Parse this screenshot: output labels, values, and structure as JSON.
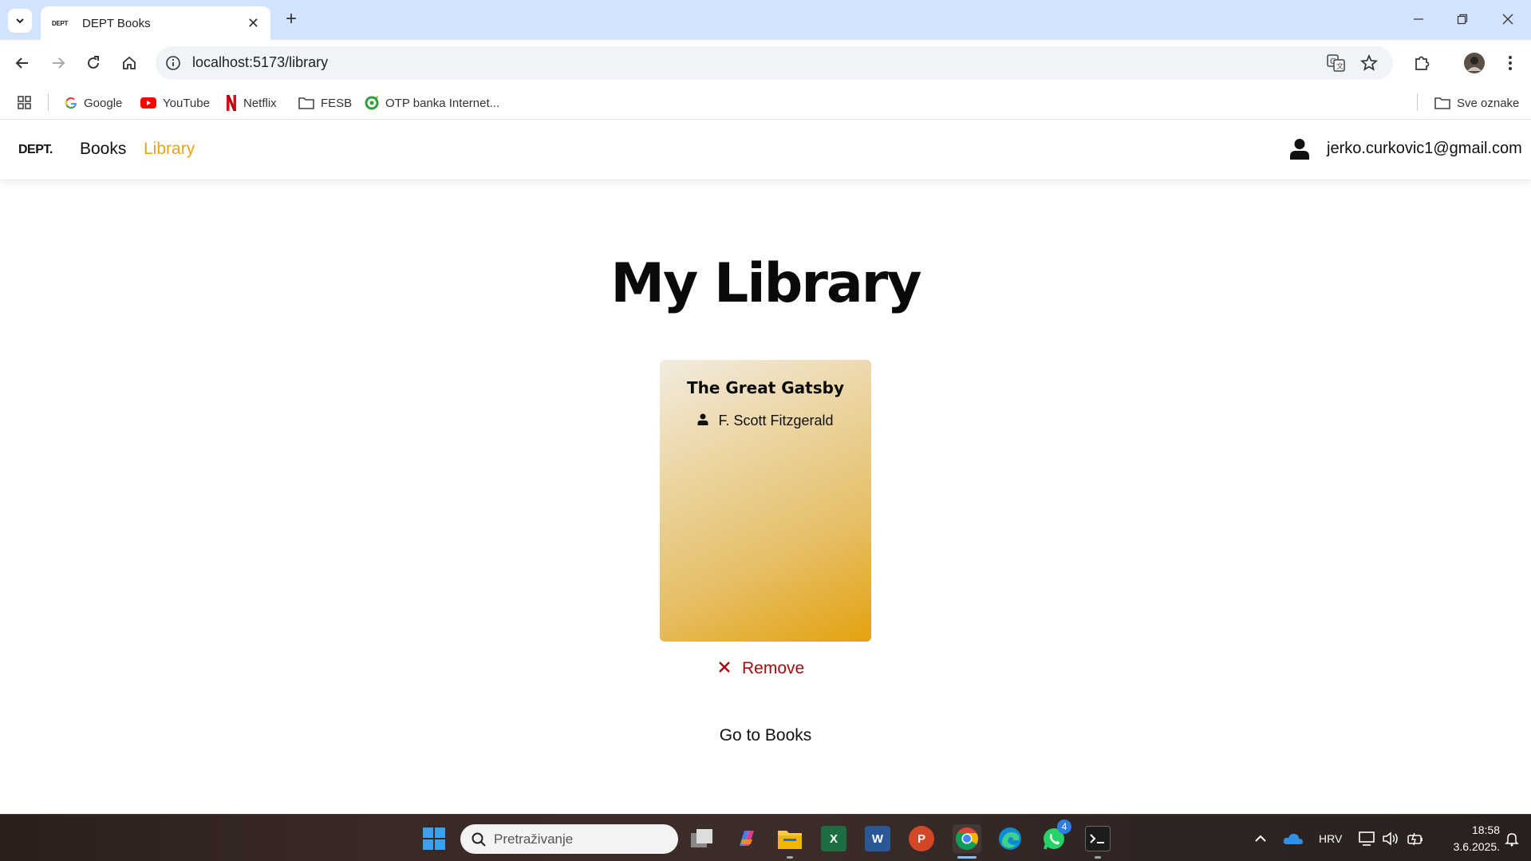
{
  "browser": {
    "tab_title": "DEPT Books",
    "tab_favicon_text": "DEPT",
    "url": "localhost:5173/library",
    "bookmarks": [
      {
        "label": "Google",
        "icon": "google-icon"
      },
      {
        "label": "YouTube",
        "icon": "youtube-icon"
      },
      {
        "label": "Netflix",
        "icon": "netflix-icon"
      },
      {
        "label": "FESB",
        "icon": "folder-icon"
      },
      {
        "label": "OTP banka Internet...",
        "icon": "otp-icon"
      }
    ],
    "all_bookmarks_label": "Sve oznake"
  },
  "app": {
    "logo": "DEPT.",
    "nav": {
      "books": "Books",
      "library": "Library"
    },
    "user_email": "jerko.curkovic1@gmail.com",
    "page_title": "My Library",
    "books": [
      {
        "title": "The Great Gatsby",
        "author": "F. Scott Fitzgerald"
      }
    ],
    "remove_label": "Remove",
    "goto_books_label": "Go to Books",
    "accent_color": "#e8a317",
    "danger_color": "#a10e0e"
  },
  "taskbar": {
    "search_placeholder": "Pretraživanje",
    "language": "HRV",
    "time": "18:58",
    "date": "3.6.2025.",
    "whatsapp_badge": "4"
  }
}
